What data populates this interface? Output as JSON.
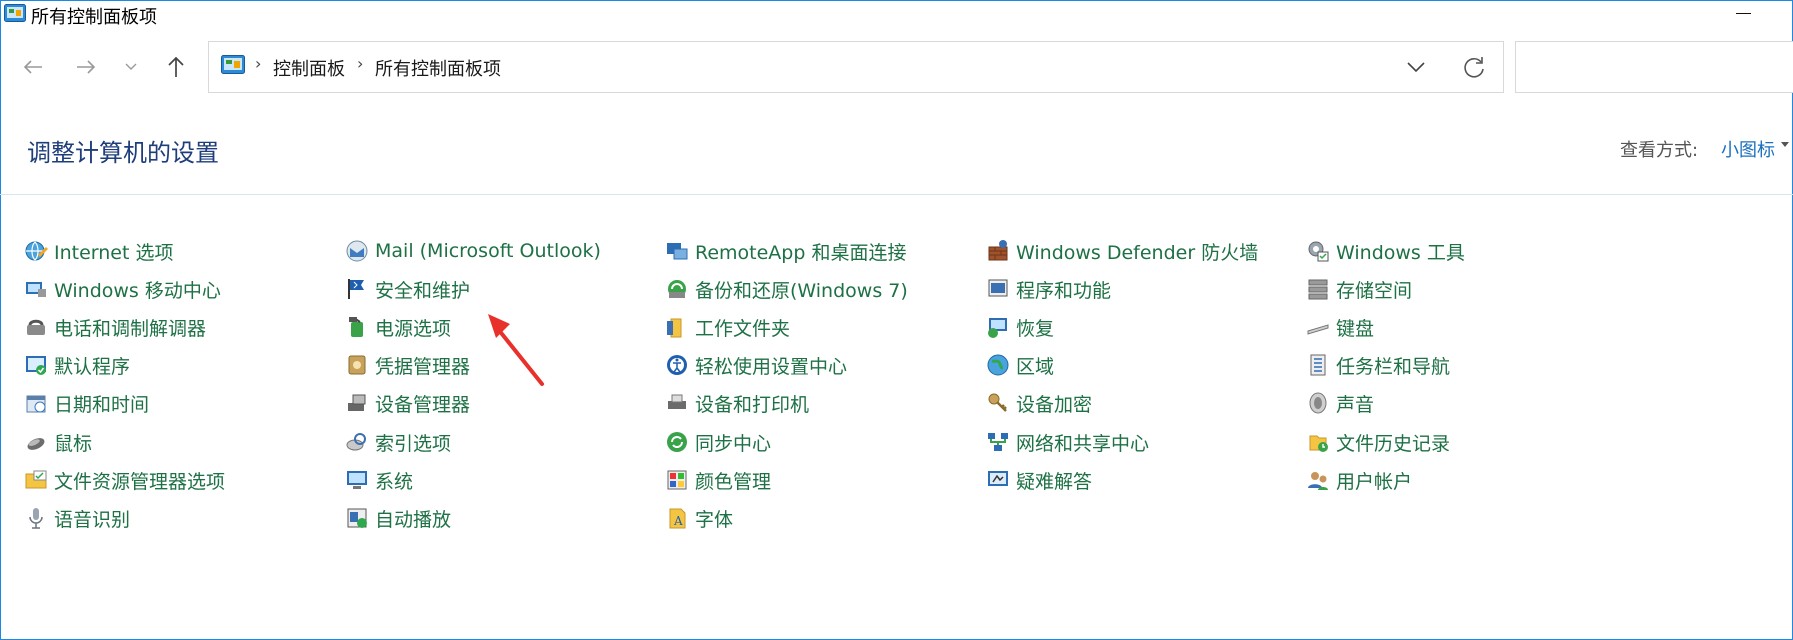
{
  "window": {
    "title": "所有控制面板项"
  },
  "nav": {
    "back_icon": "arrow-left-icon",
    "forward_icon": "arrow-right-icon",
    "recent_icon": "chevron-down-icon",
    "up_icon": "arrow-up-icon"
  },
  "address": {
    "crumbs": [
      "控制面板",
      "所有控制面板项"
    ],
    "separator": "›"
  },
  "search": {
    "placeholder": ""
  },
  "header": {
    "title": "调整计算机的设置",
    "view_label": "查看方式:",
    "view_value": "小图标"
  },
  "colors": {
    "link": "#1e7145",
    "title": "#1e3d7b",
    "accent": "#1a6fbe",
    "annotation": "#e8312a"
  },
  "columns": [
    [
      {
        "label": "Internet 选项",
        "icon": "internet-options-icon"
      },
      {
        "label": "Windows 移动中心",
        "icon": "mobility-center-icon"
      },
      {
        "label": "电话和调制解调器",
        "icon": "phone-modem-icon"
      },
      {
        "label": "默认程序",
        "icon": "default-programs-icon"
      },
      {
        "label": "日期和时间",
        "icon": "date-time-icon"
      },
      {
        "label": "鼠标",
        "icon": "mouse-icon"
      },
      {
        "label": "文件资源管理器选项",
        "icon": "folder-options-icon"
      },
      {
        "label": "语音识别",
        "icon": "microphone-icon"
      }
    ],
    [
      {
        "label": "Mail (Microsoft Outlook)",
        "icon": "mail-icon"
      },
      {
        "label": "安全和维护",
        "icon": "flag-icon"
      },
      {
        "label": "电源选项",
        "icon": "power-options-icon"
      },
      {
        "label": "凭据管理器",
        "icon": "credential-manager-icon"
      },
      {
        "label": "设备管理器",
        "icon": "device-manager-icon"
      },
      {
        "label": "索引选项",
        "icon": "indexing-icon"
      },
      {
        "label": "系统",
        "icon": "system-icon"
      },
      {
        "label": "自动播放",
        "icon": "autoplay-icon"
      }
    ],
    [
      {
        "label": "RemoteApp 和桌面连接",
        "icon": "remoteapp-icon"
      },
      {
        "label": "备份和还原(Windows 7)",
        "icon": "backup-icon"
      },
      {
        "label": "工作文件夹",
        "icon": "work-folders-icon"
      },
      {
        "label": "轻松使用设置中心",
        "icon": "ease-of-access-icon"
      },
      {
        "label": "设备和打印机",
        "icon": "printer-icon"
      },
      {
        "label": "同步中心",
        "icon": "sync-icon"
      },
      {
        "label": "颜色管理",
        "icon": "color-management-icon"
      },
      {
        "label": "字体",
        "icon": "fonts-icon"
      }
    ],
    [
      {
        "label": "Windows Defender 防火墙",
        "icon": "firewall-icon"
      },
      {
        "label": "程序和功能",
        "icon": "programs-features-icon"
      },
      {
        "label": "恢复",
        "icon": "recovery-icon"
      },
      {
        "label": "区域",
        "icon": "region-icon"
      },
      {
        "label": "设备加密",
        "icon": "encryption-key-icon"
      },
      {
        "label": "网络和共享中心",
        "icon": "network-icon"
      },
      {
        "label": "疑难解答",
        "icon": "troubleshooting-icon"
      }
    ],
    [
      {
        "label": "Windows 工具",
        "icon": "windows-tools-icon"
      },
      {
        "label": "存储空间",
        "icon": "storage-spaces-icon"
      },
      {
        "label": "键盘",
        "icon": "keyboard-icon"
      },
      {
        "label": "任务栏和导航",
        "icon": "taskbar-icon"
      },
      {
        "label": "声音",
        "icon": "speaker-icon"
      },
      {
        "label": "文件历史记录",
        "icon": "file-history-icon"
      },
      {
        "label": "用户帐户",
        "icon": "user-accounts-icon"
      }
    ]
  ]
}
